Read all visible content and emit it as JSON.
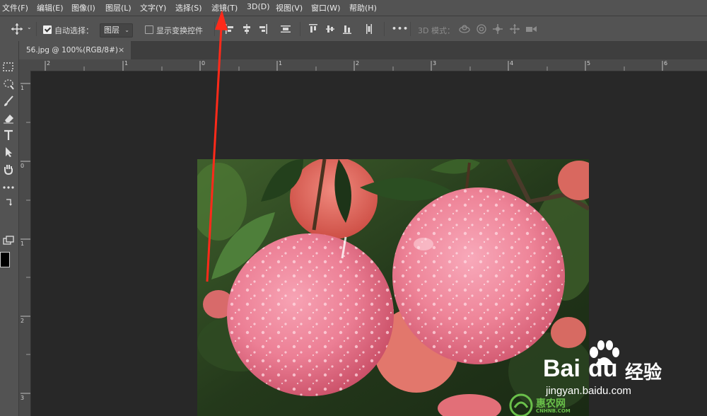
{
  "menu": [
    "文件(F)",
    "编辑(E)",
    "图像(I)",
    "图层(L)",
    "文字(Y)",
    "选择(S)",
    "滤镜(T)",
    "3D(D)",
    "视图(V)",
    "窗口(W)",
    "帮助(H)"
  ],
  "options": {
    "auto_select_label": "自动选择：",
    "auto_select_value": "图层",
    "show_transform_label": "显示变换控件",
    "more": "•••",
    "mode_3d_label": "3D 模式："
  },
  "document": {
    "tab_title": "56.jpg @ 100%(RGB/8#)",
    "close": "×"
  },
  "rulers": {
    "horizontal": [
      "2",
      "1",
      "0",
      "1",
      "2",
      "3",
      "4",
      "5",
      "6"
    ],
    "vertical": [
      "1",
      "0",
      "1",
      "2",
      "3"
    ]
  },
  "watermark": {
    "brand_bai": "Bai",
    "brand_du": "du",
    "brand_cn": "经验",
    "url": "jingyan.baidu.com",
    "logo_text": "惠农网",
    "logo_sub": "CNHNB.COM"
  },
  "colors": {
    "panel": "#535353",
    "canvas": "#282828",
    "annotation_arrow": "#ff2a1a",
    "foreground_swatch": "#000000"
  }
}
